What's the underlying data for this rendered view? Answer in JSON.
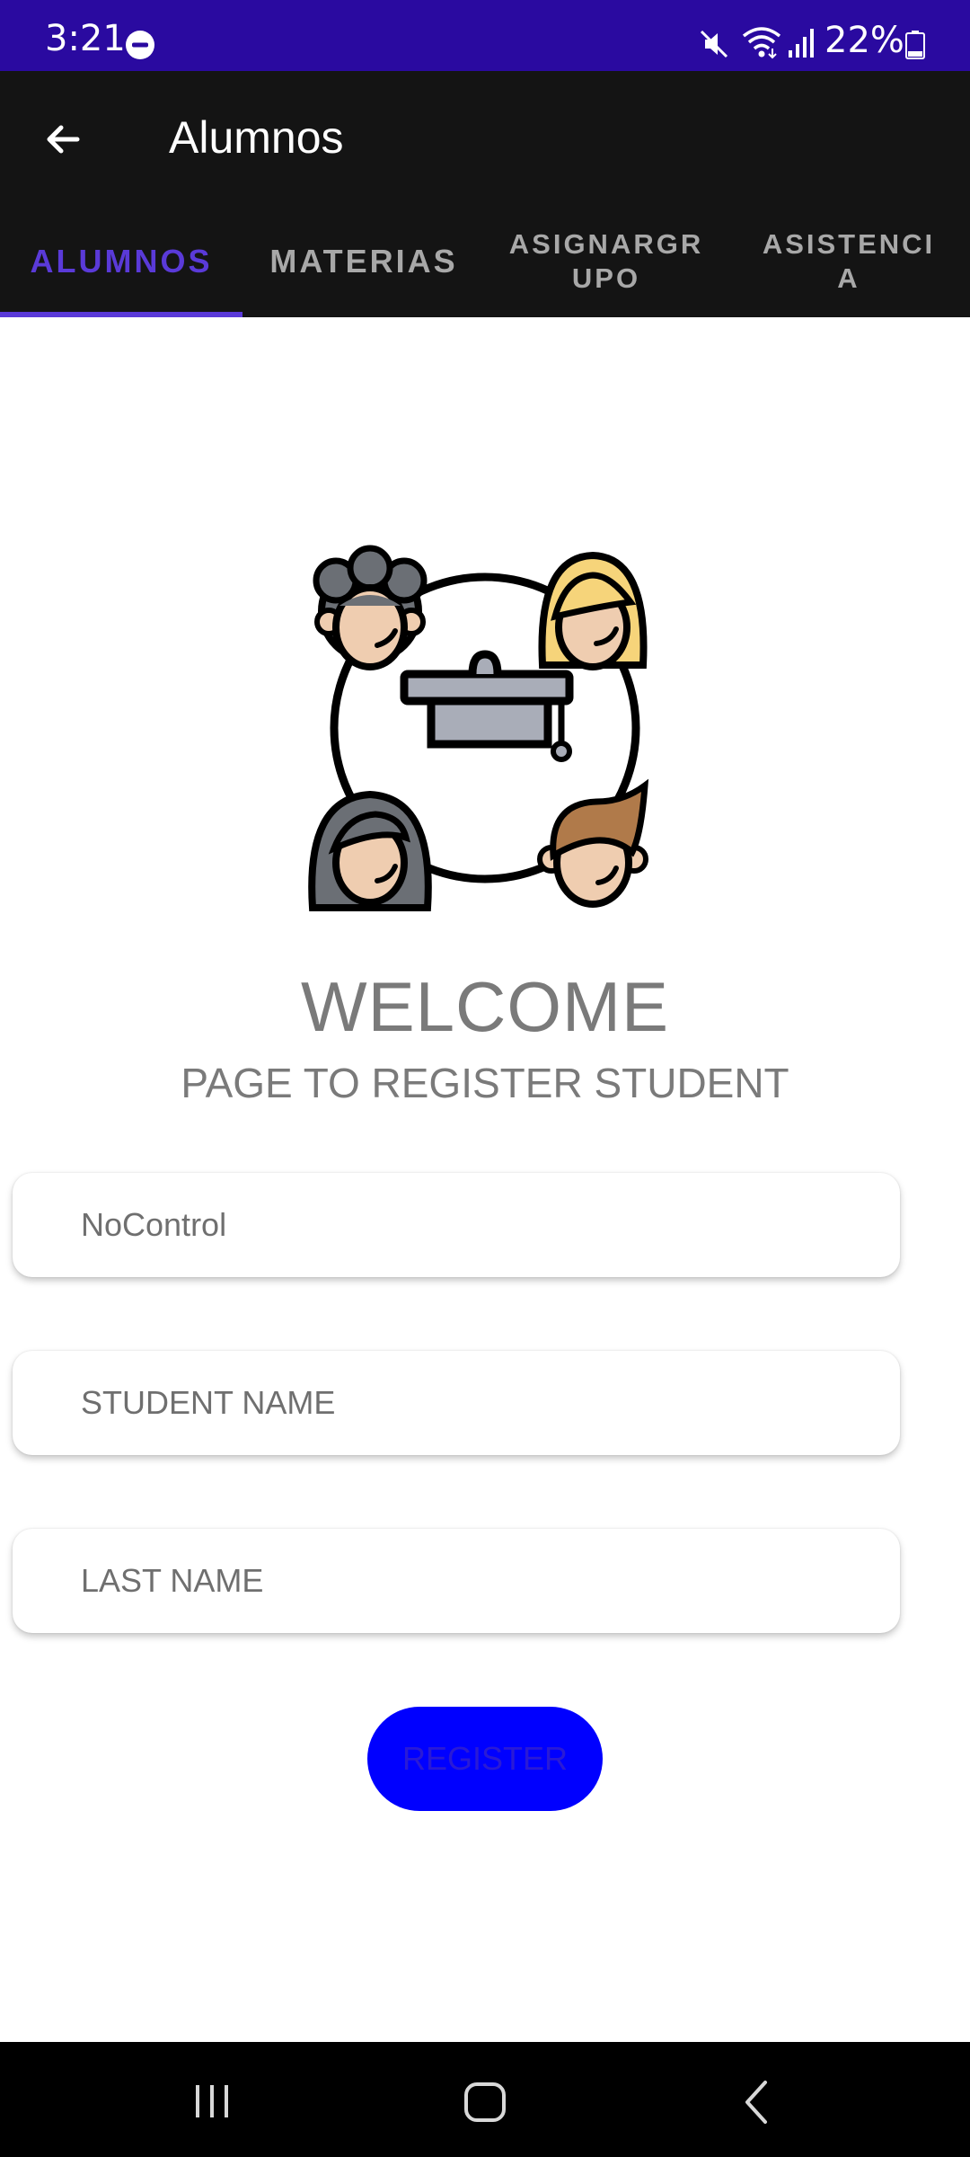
{
  "status_bar": {
    "time": "3:21",
    "battery": "22%",
    "background": "#2a0aa0",
    "icons": [
      "do-not-disturb-icon",
      "mute-icon",
      "wifi-icon",
      "signal-icon",
      "battery-icon"
    ]
  },
  "app_bar": {
    "title": "Alumnos",
    "back_icon": "arrow-left-icon",
    "background": "#141414"
  },
  "tabs": {
    "items": [
      {
        "label": "ALUMNOS",
        "active": true
      },
      {
        "label": "MATERIAS",
        "active": false
      },
      {
        "label": "ASIGNARGR\nUPO",
        "active": false
      },
      {
        "label": "ASISTENCI\nA",
        "active": false
      }
    ],
    "accent": "#5a3ad8"
  },
  "main": {
    "illustration": "students-group-icon",
    "welcome": "WELCOME",
    "subtitle": "PAGE TO REGISTER STUDENT"
  },
  "form": {
    "nocontrol": {
      "placeholder": "NoControl",
      "value": ""
    },
    "student_name": {
      "placeholder": "STUDENT NAME",
      "value": ""
    },
    "last_name": {
      "placeholder": "LAST NAME",
      "value": ""
    },
    "register_label": "REGISTER",
    "register_color": "#0000ff"
  },
  "nav_bar": {
    "icons": [
      "recents-icon",
      "home-icon",
      "back-icon"
    ]
  }
}
